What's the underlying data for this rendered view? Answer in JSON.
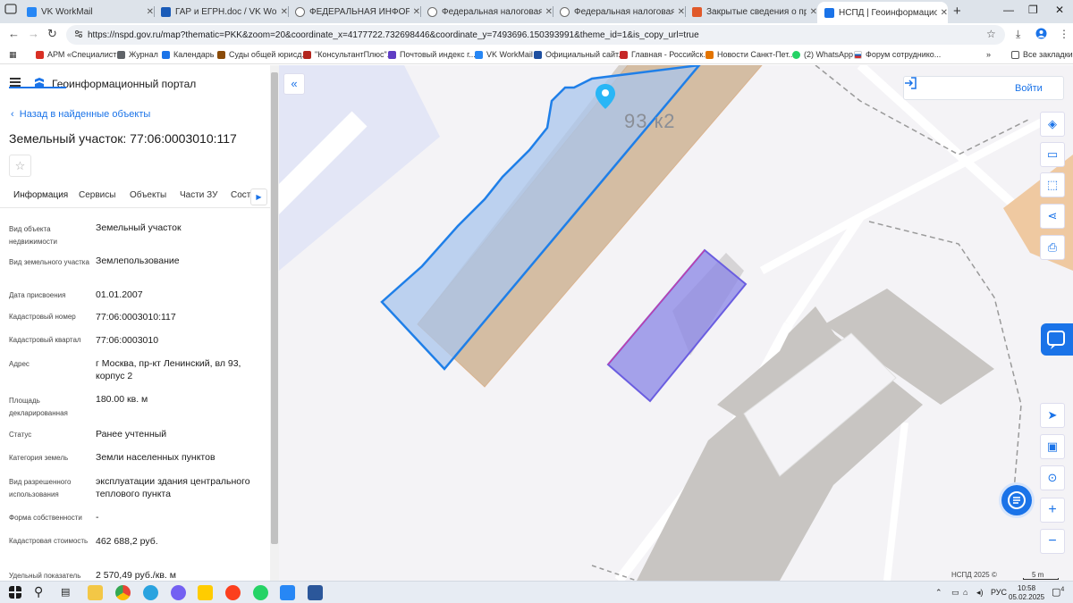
{
  "browser": {
    "tabs": [
      {
        "label": "VK WorkMail",
        "color": "#2787f5"
      },
      {
        "label": "ГАР и ЕГРН.doc / VK WorkDisk",
        "color": "#1a5bb8"
      },
      {
        "label": "ФЕДЕРАЛЬНАЯ ИНФОРМАЦИОН",
        "color": "#6b6b6b"
      },
      {
        "label": "Федеральная налоговая служ",
        "color": "#6b6b6b"
      },
      {
        "label": "Федеральная налоговая служ",
        "color": "#6b6b6b"
      },
      {
        "label": "Закрытые сведения о правоо",
        "color": "#e0592a"
      },
      {
        "label": "НСПД | Геоинформационный п",
        "color": "#1a73e8"
      }
    ],
    "new_tab": "+",
    "address": "https://nspd.gov.ru/map?thematic=PKK&zoom=20&coordinate_x=4177722.732698446&coordinate_y=7493696.150393991&theme_id=1&is_copy_url=true",
    "bookmarks": [
      {
        "label": "АРМ «Специалист»",
        "color": "#d93025"
      },
      {
        "label": "Журнал",
        "color": "#5f6368"
      },
      {
        "label": "Календарь",
        "color": "#1a73e8"
      },
      {
        "label": "Суды общей юрисд...",
        "color": "#8a4b08"
      },
      {
        "label": "\"КонсультантПлюс\"...",
        "color": "#b3261e"
      },
      {
        "label": "Почтовый индекс г...",
        "color": "#5f3dc4"
      },
      {
        "label": "VK WorkMail",
        "color": "#2787f5"
      },
      {
        "label": "Официальный сайт...",
        "color": "#1e4fa0"
      },
      {
        "label": "Главная - Российск...",
        "color": "#c62828"
      },
      {
        "label": "Новости Санкт-Пет...",
        "color": "#e37400"
      },
      {
        "label": "(2) WhatsApp",
        "color": "#25d366"
      },
      {
        "label": "Форум сотруднико...",
        "color": "#1565c0"
      }
    ],
    "bookmarks_overflow": "»",
    "all_bookmarks": "Все закладки"
  },
  "app": {
    "title": "Геоинформационный портал",
    "back_link": "Назад в найденные объекты",
    "object_title": "Земельный участок: 77:06:0003010:117",
    "tabs": [
      "Информация",
      "Сервисы",
      "Объекты",
      "Части ЗУ",
      "Состав"
    ],
    "fields": [
      {
        "label": "Вид объекта недвижимости",
        "value": "Земельный участок"
      },
      {
        "label": "Вид земельного участка",
        "value": "Землепользование"
      },
      {
        "label": "Дата присвоения",
        "value": "01.01.2007"
      },
      {
        "label": "Кадастровый номер",
        "value": "77:06:0003010:117"
      },
      {
        "label": "Кадастровый квартал",
        "value": "77:06:0003010"
      },
      {
        "label": "Адрес",
        "value": "г Москва, пр-кт Ленинский, вл 93, корпус 2"
      },
      {
        "label": "Площадь декларированная",
        "value": "180.00 кв. м"
      },
      {
        "label": "Статус",
        "value": "Ранее учтенный"
      },
      {
        "label": "Категория земель",
        "value": "Земли населенных пунктов"
      },
      {
        "label": "Вид разрешенного использования",
        "value": "эксплуатации здания центрального теплового пункта"
      },
      {
        "label": "Форма собственности",
        "value": "-"
      },
      {
        "label": "Кадастровая стоимость",
        "value": "462 688,2 руб."
      },
      {
        "label": "Удельный показатель",
        "value": "2 570,49 руб./кв. м"
      }
    ]
  },
  "map": {
    "house_label": "93 к2",
    "login_label": "Войти",
    "attribution": "НСПД 2025 ©",
    "scale": "5 m",
    "controls": [
      "layers-icon",
      "ruler-icon",
      "select-area-icon",
      "share-icon",
      "print-icon",
      "locate-icon",
      "basemap-icon",
      "search-map-icon",
      "zoom-in-icon",
      "zoom-out-icon"
    ],
    "colors": {
      "parcel_outline": "#1f7fe8",
      "parcel_fill": "#a9c6ec",
      "building": "#c8c5c2",
      "orange_zone": "#efc9a1",
      "selected": "#6a5de0"
    }
  },
  "taskbar": {
    "lang": "РУС",
    "time": "10:58",
    "date": "05.02.2025",
    "notifications": "4"
  }
}
